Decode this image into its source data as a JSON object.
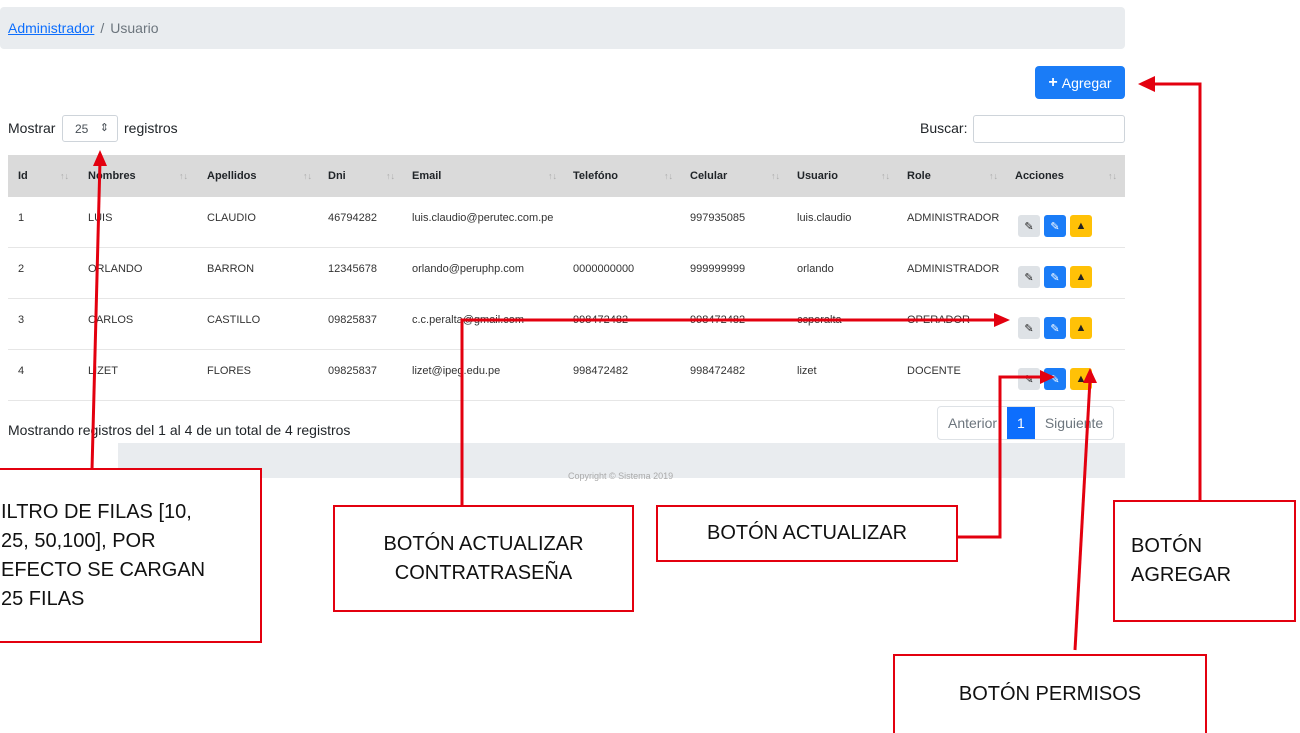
{
  "breadcrumb": {
    "root": "Administrador",
    "sep": "/",
    "current": "Usuario"
  },
  "toolbar": {
    "add_label": "Agregar"
  },
  "length": {
    "show_label": "Mostrar",
    "value": "25",
    "suffix_label": "registros"
  },
  "search": {
    "label": "Buscar:"
  },
  "table": {
    "columns": [
      "Id",
      "Nombres",
      "Apellidos",
      "Dni",
      "Email",
      "Telefóno",
      "Celular",
      "Usuario",
      "Role",
      "Acciones"
    ],
    "rows": [
      [
        "1",
        "LUIS",
        "CLAUDIO",
        "46794282",
        "luis.claudio@perutec.com.pe",
        "",
        "997935085",
        "luis.claudio",
        "ADMINISTRADOR"
      ],
      [
        "2",
        "ORLANDO",
        "BARRON",
        "12345678",
        "orlando@peruphp.com",
        "0000000000",
        "999999999",
        "orlando",
        "ADMINISTRADOR"
      ],
      [
        "3",
        "CARLOS",
        "CASTILLO",
        "09825837",
        "c.c.peralta@gmail.com",
        "998472482",
        "998472482",
        "ccperalta",
        "OPERADOR"
      ],
      [
        "4",
        "LIZET",
        "FLORES",
        "09825837",
        "lizet@ipeg.edu.pe",
        "998472482",
        "998472482",
        "lizet",
        "DOCENTE"
      ]
    ]
  },
  "info": {
    "text": "Mostrando registros del 1 al 4 de un total de 4 registros"
  },
  "pagination": {
    "prev": "Anterior",
    "current": "1",
    "next": "Siguiente"
  },
  "footer": {
    "text": "Copyright © Sistema 2019"
  },
  "annotations": {
    "filter": [
      "ILTRO DE FILAS [10,",
      "25, 50,100], POR",
      "EFECTO SE CARGAN",
      "25 FILAS"
    ],
    "password": [
      "BOTÓN ACTUALIZAR",
      "CONTRATRASEÑA"
    ],
    "update": "BOTÓN ACTUALIZAR",
    "add": [
      "BOTÓN",
      "AGREGAR"
    ],
    "permissions": "BOTÓN PERMISOS"
  },
  "colors": {
    "primary": "#1a7cf7",
    "warning": "#ffc107",
    "annotation": "#e3000f"
  }
}
